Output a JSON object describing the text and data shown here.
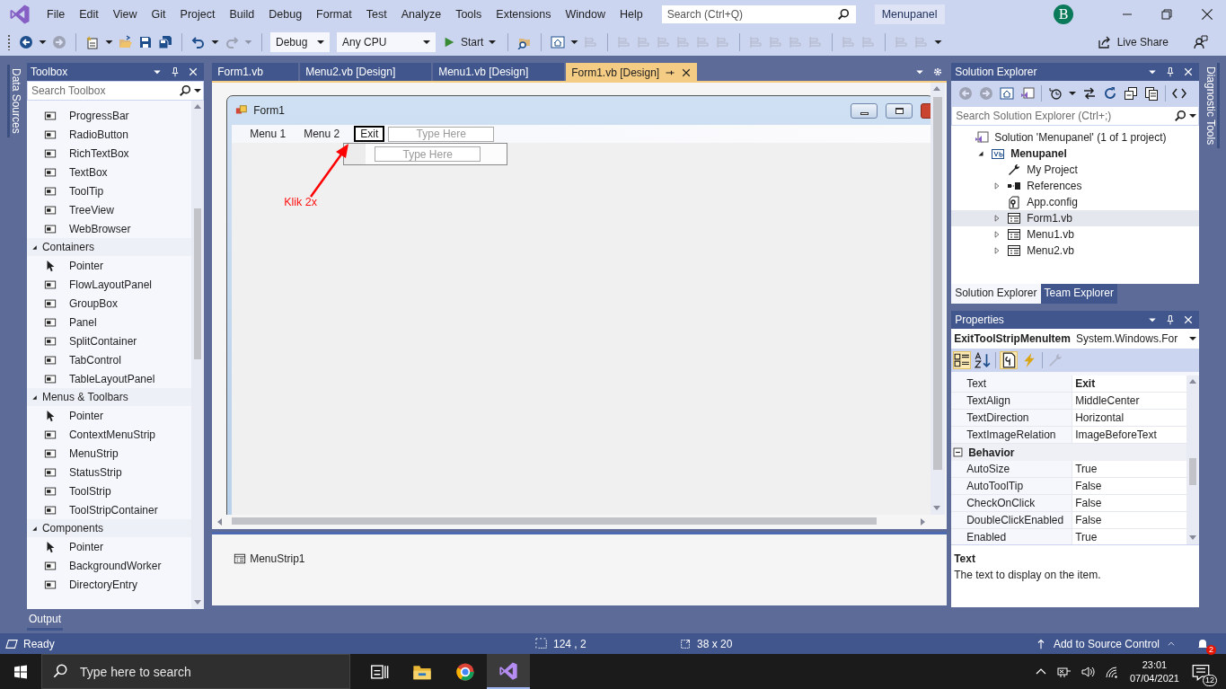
{
  "menu_bar": {
    "items": [
      "File",
      "Edit",
      "View",
      "Git",
      "Project",
      "Build",
      "Debug",
      "Format",
      "Test",
      "Analyze",
      "Tools",
      "Extensions",
      "Window",
      "Help"
    ],
    "search": {
      "placeholder": "Search (Ctrl+Q)"
    },
    "solution_name": "Menupanel",
    "account_initial": "B"
  },
  "toolbar": {
    "groups_left": [
      [
        {
          "kind": "back",
          "disabled": false
        },
        {
          "kind": "caret",
          "disabled": false
        },
        {
          "kind": "forward",
          "disabled": true
        }
      ],
      [
        {
          "kind": "new",
          "disabled": false
        },
        {
          "kind": "caret",
          "disabled": false
        },
        {
          "kind": "open",
          "disabled": false
        },
        {
          "kind": "save",
          "disabled": false
        },
        {
          "kind": "saveall",
          "disabled": false
        }
      ],
      [
        {
          "kind": "undo",
          "disabled": false
        },
        {
          "kind": "caret",
          "disabled": false
        },
        {
          "kind": "redo",
          "disabled": true
        },
        {
          "kind": "caret",
          "disabled": true
        }
      ]
    ],
    "configuration": "Debug",
    "platform": "Any CPU",
    "start": "Start",
    "groups_right": [
      [
        {
          "kind": "find",
          "disabled": false
        }
      ],
      [
        {
          "kind": "home",
          "disabled": false
        },
        {
          "kind": "caret",
          "disabled": false
        },
        {
          "kind": "layout",
          "disabled": true
        }
      ],
      [
        {
          "kind": "layout",
          "disabled": true
        },
        {
          "kind": "layout",
          "disabled": true
        },
        {
          "kind": "layout",
          "disabled": true
        },
        {
          "kind": "layout",
          "disabled": true
        },
        {
          "kind": "layout",
          "disabled": true
        },
        {
          "kind": "layout",
          "disabled": true
        }
      ],
      [
        {
          "kind": "layout",
          "disabled": true
        },
        {
          "kind": "layout",
          "disabled": true
        },
        {
          "kind": "layout",
          "disabled": true
        },
        {
          "kind": "layout",
          "disabled": true
        }
      ],
      [
        {
          "kind": "layout",
          "disabled": true
        },
        {
          "kind": "layout",
          "disabled": true
        }
      ],
      [
        {
          "kind": "layout",
          "disabled": true
        },
        {
          "kind": "layout",
          "disabled": true
        },
        {
          "kind": "caret",
          "disabled": false
        }
      ]
    ],
    "live_share": "Live Share"
  },
  "left_side_tab": "Data Sources",
  "toolbox": {
    "title": "Toolbox",
    "search": {
      "placeholder": "Search Toolbox"
    },
    "groups": [
      {
        "items": [
          {
            "kind": "control",
            "label": "ProgressBar"
          },
          {
            "kind": "control",
            "label": "RadioButton"
          },
          {
            "kind": "control",
            "label": "RichTextBox"
          },
          {
            "kind": "control",
            "label": "TextBox"
          },
          {
            "kind": "control",
            "label": "ToolTip"
          },
          {
            "kind": "control",
            "label": "TreeView"
          },
          {
            "kind": "control",
            "label": "WebBrowser"
          }
        ]
      },
      {
        "title": "Containers",
        "expanded": true,
        "items": [
          {
            "kind": "pointer",
            "label": "Pointer"
          },
          {
            "kind": "control",
            "label": "FlowLayoutPanel"
          },
          {
            "kind": "control",
            "label": "GroupBox"
          },
          {
            "kind": "control",
            "label": "Panel"
          },
          {
            "kind": "control",
            "label": "SplitContainer"
          },
          {
            "kind": "control",
            "label": "TabControl"
          },
          {
            "kind": "control",
            "label": "TableLayoutPanel"
          }
        ]
      },
      {
        "title": "Menus & Toolbars",
        "expanded": true,
        "items": [
          {
            "kind": "pointer",
            "label": "Pointer"
          },
          {
            "kind": "control",
            "label": "ContextMenuStrip"
          },
          {
            "kind": "control",
            "label": "MenuStrip"
          },
          {
            "kind": "control",
            "label": "StatusStrip"
          },
          {
            "kind": "control",
            "label": "ToolStrip"
          },
          {
            "kind": "control",
            "label": "ToolStripContainer"
          }
        ]
      },
      {
        "title": "Components",
        "expanded": true,
        "items": [
          {
            "kind": "pointer",
            "label": "Pointer"
          },
          {
            "kind": "control",
            "label": "BackgroundWorker"
          },
          {
            "kind": "control",
            "label": "DirectoryEntry"
          }
        ]
      }
    ]
  },
  "editor": {
    "tabs": [
      {
        "label": "Form1.vb",
        "selected": false
      },
      {
        "label": "Menu2.vb [Design]",
        "selected": false
      },
      {
        "label": "Menu1.vb [Design]",
        "selected": false
      },
      {
        "label": "Form1.vb [Design]",
        "selected": true
      }
    ],
    "form": {
      "title": "Form1",
      "menu_items": [
        {
          "label": "Menu 1",
          "selected": false
        },
        {
          "label": "Menu 2",
          "selected": false
        },
        {
          "label": "Exit",
          "selected": true
        }
      ],
      "menu_placeholder": "Type Here",
      "dropdown_placeholder": "Type Here"
    },
    "annotation": "Klik 2x",
    "tray_items": [
      "MenuStrip1"
    ]
  },
  "solution_explorer": {
    "title": "Solution Explorer",
    "search": {
      "placeholder": "Search Solution Explorer (Ctrl+;)"
    },
    "tree": [
      {
        "label": "Solution 'Menupanel' (1 of 1 project)",
        "kind": "solution",
        "selected": false,
        "children": [
          {
            "label": "Menupanel",
            "kind": "project",
            "expanded": true,
            "selected": false,
            "children": [
              {
                "label": "My Project",
                "kind": "settings",
                "selected": false
              },
              {
                "label": "References",
                "kind": "references",
                "expanded": false,
                "selected": false
              },
              {
                "label": "App.config",
                "kind": "config",
                "selected": false
              },
              {
                "label": "Form1.vb",
                "kind": "form",
                "expanded": false,
                "selected": true
              },
              {
                "label": "Menu1.vb",
                "kind": "form",
                "expanded": false,
                "selected": false
              },
              {
                "label": "Menu2.vb",
                "kind": "form",
                "expanded": false,
                "selected": false
              }
            ]
          }
        ]
      }
    ],
    "tabs": [
      {
        "label": "Solution Explorer",
        "selected": true
      },
      {
        "label": "Team Explorer",
        "selected": false
      }
    ]
  },
  "properties": {
    "title": "Properties",
    "object_name": "ExitToolStripMenuItem",
    "object_type": "System.Windows.For",
    "rows": [
      {
        "kind": "property",
        "name": "Text",
        "value": "Exit",
        "modified": true
      },
      {
        "kind": "property",
        "name": "TextAlign",
        "value": "MiddleCenter",
        "modified": false
      },
      {
        "kind": "property",
        "name": "TextDirection",
        "value": "Horizontal",
        "modified": false
      },
      {
        "kind": "property",
        "name": "TextImageRelation",
        "value": "ImageBeforeText",
        "modified": false
      },
      {
        "kind": "category",
        "name": "Behavior",
        "expanded": true
      },
      {
        "kind": "property",
        "name": "AutoSize",
        "value": "True",
        "modified": false
      },
      {
        "kind": "property",
        "name": "AutoToolTip",
        "value": "False",
        "modified": false
      },
      {
        "kind": "property",
        "name": "CheckOnClick",
        "value": "False",
        "modified": false
      },
      {
        "kind": "property",
        "name": "DoubleClickEnabled",
        "value": "False",
        "modified": false
      },
      {
        "kind": "property",
        "name": "Enabled",
        "value": "True",
        "modified": false
      }
    ],
    "description_title": "Text",
    "description": "The text to display on the item."
  },
  "right_side_tab": "Diagnostic Tools",
  "bottom_tab": "Output",
  "status_bar": {
    "state": "Ready",
    "position": "124 , 2",
    "size": "38 x 20",
    "source_control": "Add to Source Control",
    "notifications": "2"
  },
  "taskbar": {
    "search": {
      "placeholder": "Type here to search"
    },
    "time": "23:01",
    "date": "07/04/2021",
    "notifications": "12"
  }
}
